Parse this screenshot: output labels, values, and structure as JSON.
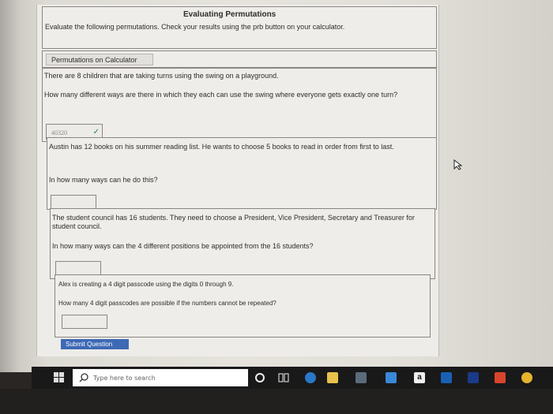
{
  "page": {
    "title": "Evaluating Permutations",
    "instructions": "Evaluate the following permutations. Check your results using the prb button on your calculator.",
    "calculator_button": "Permutations on Calculator"
  },
  "questions": [
    {
      "prompt": "There are 8 children that are taking turns using the swing on a playground.",
      "question": "How many different ways are there in which they each can use the swing where everyone gets exactly one turn?",
      "answer": "40320",
      "correct": true
    },
    {
      "prompt": "Austin has 12 books on his summer reading list. He wants to choose 5 books to read in order from first to last.",
      "question": "In how many ways can he do this?",
      "answer": ""
    },
    {
      "prompt": "The student council has 16 students. They need to choose a President, Vice President, Secretary and Treasurer for student council.",
      "question": "In how many ways can the 4 different positions be appointed from the 16 students?",
      "answer": ""
    },
    {
      "prompt": "Alex is creating a 4 digit passcode using the digits 0 through 9.",
      "question": "How many 4 digit passcodes are possible if the numbers cannot be repeated?",
      "answer": ""
    }
  ],
  "submit_label": "Submit Question",
  "taskbar": {
    "search_placeholder": "Type here to search",
    "amazon_letter": "a",
    "icons": [
      "windows-icon",
      "search-icon",
      "cortana-icon",
      "task-view-icon",
      "edge-icon",
      "files-icon",
      "store-icon",
      "mail-icon",
      "amazon-icon",
      "dropbox-icon",
      "app-icon",
      "office-icon",
      "chrome-icon"
    ]
  },
  "colors": {
    "submit": "#3d69b5",
    "check": "#2f7a3a"
  }
}
